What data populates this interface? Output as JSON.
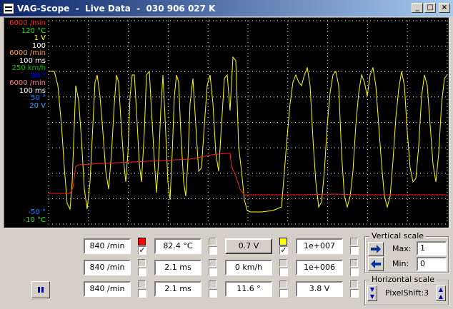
{
  "window": {
    "title": "VAG-Scope  -  Live Data  -  030 906 027 K",
    "buttons": {
      "minimize": "_",
      "maximize": "□",
      "close": "×"
    }
  },
  "scope": {
    "background": "#000000",
    "grid_color": "#808000",
    "axis_labels": [
      {
        "text": "6000 /min",
        "color": "#ff2020"
      },
      {
        "text": "120 °C",
        "color": "#00ff00"
      },
      {
        "text": "1 V",
        "color": "#ffff00"
      },
      {
        "text": "100",
        "color": "#ffffff"
      },
      {
        "text": "6000 /min",
        "color": "#ffa060"
      },
      {
        "text": "100 ms",
        "color": "#ffffff"
      },
      {
        "text": "250 km/h",
        "color": "#00c000"
      },
      {
        "text": "90 °",
        "color": "#0000ff"
      },
      {
        "text": "6000 /min",
        "color": "#ff8080"
      },
      {
        "text": "100 ms",
        "color": "#ffffff"
      },
      {
        "text": "50 °",
        "color": "#2080ff"
      },
      {
        "text": "20 V",
        "color": "#40a0ff"
      }
    ],
    "bottom_labels": [
      {
        "text": "-50 °",
        "color": "#2080ff"
      },
      {
        "text": "-10 °C",
        "color": "#00ff00"
      }
    ]
  },
  "meters": {
    "row1": [
      {
        "value": "840 /min",
        "swatch": "#ff0000",
        "checked": "✓"
      },
      {
        "value": "82.4 °C",
        "swatch": "",
        "checked": ""
      },
      {
        "value": "0.7 V",
        "swatch": "#ffff00",
        "checked": "✓"
      },
      {
        "value": "1e+007",
        "swatch": "",
        "checked": ""
      }
    ],
    "row2": [
      {
        "value": "840 /min",
        "swatch": "",
        "checked": ""
      },
      {
        "value": "2.1 ms",
        "swatch": "",
        "checked": ""
      },
      {
        "value": "0 km/h",
        "swatch": "",
        "checked": ""
      },
      {
        "value": "1e+006",
        "swatch": "",
        "checked": ""
      }
    ],
    "row3": [
      {
        "value": "840 /min",
        "swatch": "",
        "checked": ""
      },
      {
        "value": "2.1 ms",
        "swatch": "",
        "checked": ""
      },
      {
        "value": "11.6 °",
        "swatch": "",
        "checked": ""
      },
      {
        "value": "3.8 V",
        "swatch": "",
        "checked": ""
      }
    ]
  },
  "vertical_scale": {
    "title": "Vertical scale",
    "max_label": "Max:",
    "max_value": "1",
    "min_label": "Min:",
    "min_value": "0"
  },
  "horizontal_scale": {
    "title": "Horizontal scale",
    "pixel_shift_label": "PixelShift:3"
  },
  "icons": {
    "app": "app-logo-icon",
    "pause": "pause-icon",
    "up": "arrow-right-icon",
    "down": "arrow-left-icon"
  }
}
